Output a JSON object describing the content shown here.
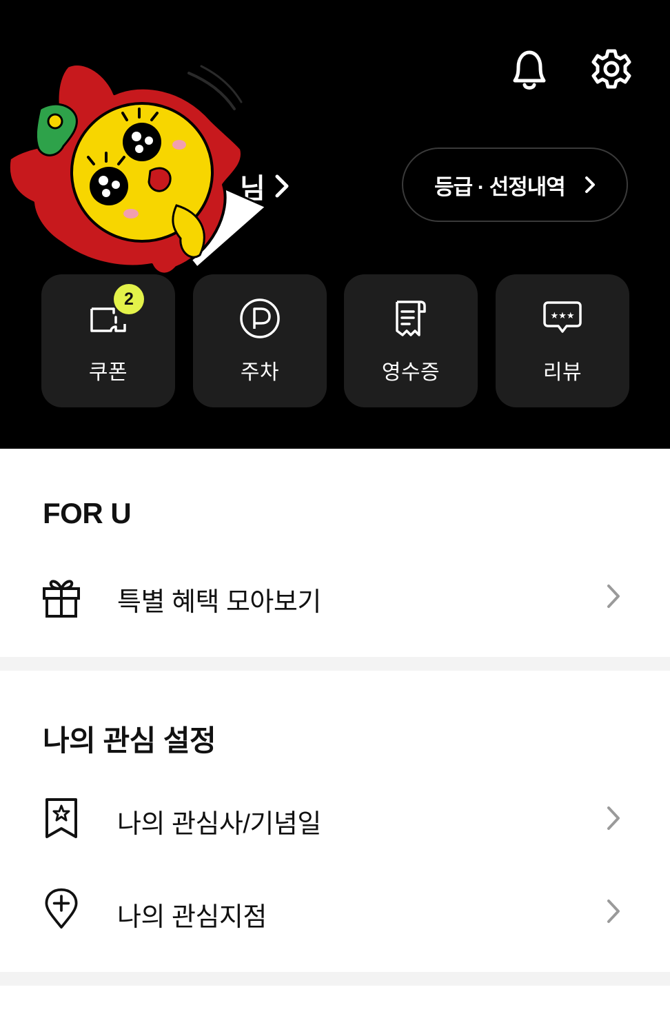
{
  "header": {
    "user_name_suffix": "님",
    "grade_button_label": "등급 · 선정내역",
    "icons": [
      "bell-icon",
      "gear-icon"
    ]
  },
  "quick_menu": [
    {
      "label": "쿠폰",
      "icon": "coupon-icon",
      "badge": "2"
    },
    {
      "label": "주차",
      "icon": "parking-icon"
    },
    {
      "label": "영수증",
      "icon": "receipt-icon"
    },
    {
      "label": "리뷰",
      "icon": "review-icon"
    }
  ],
  "for_u": {
    "title": "FOR U",
    "items": [
      {
        "label": "특별 혜택 모아보기",
        "icon": "gift-icon"
      }
    ]
  },
  "interests": {
    "title": "나의 관심 설정",
    "items": [
      {
        "label": "나의 관심사/기념일",
        "icon": "bookmark-star-icon"
      },
      {
        "label": "나의 관심지점",
        "icon": "location-plus-icon"
      }
    ]
  },
  "colors": {
    "header_bg": "#000000",
    "tile_bg": "#1e1e1e",
    "badge": "#e3f24a",
    "divider": "#f3f3f3"
  }
}
